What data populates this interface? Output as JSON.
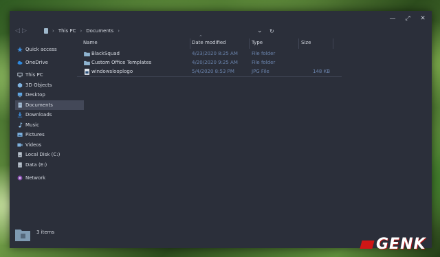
{
  "breadcrumb": [
    "This PC",
    "Documents"
  ],
  "sidebar": {
    "items": [
      {
        "label": "Quick access",
        "icon": "star-icon"
      },
      {
        "label": "OneDrive",
        "icon": "cloud-icon"
      },
      {
        "label": "This PC",
        "icon": "computer-icon"
      },
      {
        "label": "3D Objects",
        "icon": "cube-icon"
      },
      {
        "label": "Desktop",
        "icon": "desktop-icon"
      },
      {
        "label": "Documents",
        "icon": "documents-icon"
      },
      {
        "label": "Downloads",
        "icon": "download-icon"
      },
      {
        "label": "Music",
        "icon": "music-icon"
      },
      {
        "label": "Pictures",
        "icon": "pictures-icon"
      },
      {
        "label": "Videos",
        "icon": "video-icon"
      },
      {
        "label": "Local Disk (C:)",
        "icon": "drive-icon"
      },
      {
        "label": "Data (E:)",
        "icon": "drive-icon"
      },
      {
        "label": "Network",
        "icon": "network-icon"
      }
    ]
  },
  "columns": {
    "name": "Name",
    "date": "Date modified",
    "type": "Type",
    "size": "Size"
  },
  "files": [
    {
      "name": "BlackSquad",
      "date": "4/23/2020 8:25 AM",
      "type": "File folder",
      "size": "",
      "icon": "folder-icon"
    },
    {
      "name": "Custom Office Templates",
      "date": "4/20/2020 9:25 AM",
      "type": "File folder",
      "size": "",
      "icon": "folder-icon"
    },
    {
      "name": "windowslooplogo",
      "date": "5/4/2020 8:53 PM",
      "type": "JPG File",
      "size": "148 KB",
      "icon": "image-file-icon"
    }
  ],
  "status": {
    "item_count": "3 items"
  },
  "watermark": {
    "text": "GENK"
  },
  "colors": {
    "window_bg": "#2b2f3a",
    "selected_bg": "#434858",
    "meta_text": "#6b84ad",
    "accent_red": "#d01616"
  }
}
